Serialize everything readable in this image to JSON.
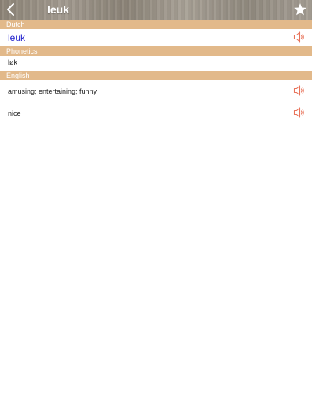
{
  "navbar": {
    "title": "leuk",
    "back_icon": "chevron-left-icon",
    "favorite_icon": "star-icon"
  },
  "sections": {
    "source": {
      "header": "Dutch",
      "word": "leuk"
    },
    "phonetics": {
      "header": "Phonetics",
      "value": "løk"
    },
    "english": {
      "header": "English",
      "translations": [
        "amusing; entertaining; funny",
        "nice"
      ]
    }
  },
  "colors": {
    "header_bg": "#e2b98a",
    "word_color": "#1a1acc",
    "speaker_color": "#e8735a"
  }
}
